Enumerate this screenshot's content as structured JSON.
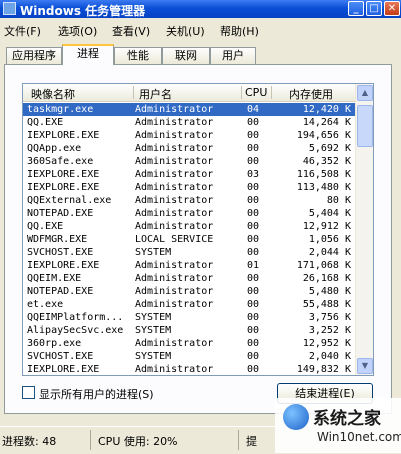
{
  "window": {
    "title": "Windows 任务管理器",
    "controls": [
      "_",
      "□",
      "✕"
    ]
  },
  "menu": [
    "文件(F)",
    "选项(O)",
    "查看(V)",
    "关机(U)",
    "帮助(H)"
  ],
  "tabs": [
    "应用程序",
    "进程",
    "性能",
    "联网",
    "用户"
  ],
  "active_tab": "进程",
  "columns": {
    "name": "映像名称",
    "user": "用户名",
    "cpu": "CPU",
    "mem": "内存使用"
  },
  "rows": [
    {
      "name": "taskmgr.exe",
      "user": "Administrator",
      "cpu": "04",
      "mem": "12,420 K",
      "selected": true
    },
    {
      "name": "QQ.EXE",
      "user": "Administrator",
      "cpu": "00",
      "mem": "14,264 K"
    },
    {
      "name": "IEXPLORE.EXE",
      "user": "Administrator",
      "cpu": "00",
      "mem": "194,656 K"
    },
    {
      "name": "QQApp.exe",
      "user": "Administrator",
      "cpu": "00",
      "mem": "5,692 K"
    },
    {
      "name": "360Safe.exe",
      "user": "Administrator",
      "cpu": "00",
      "mem": "46,352 K"
    },
    {
      "name": "IEXPLORE.EXE",
      "user": "Administrator",
      "cpu": "03",
      "mem": "116,508 K"
    },
    {
      "name": "IEXPLORE.EXE",
      "user": "Administrator",
      "cpu": "00",
      "mem": "113,480 K"
    },
    {
      "name": "QQExternal.exe",
      "user": "Administrator",
      "cpu": "00",
      "mem": "80 K"
    },
    {
      "name": "NOTEPAD.EXE",
      "user": "Administrator",
      "cpu": "00",
      "mem": "5,404 K"
    },
    {
      "name": "QQ.EXE",
      "user": "Administrator",
      "cpu": "00",
      "mem": "12,912 K"
    },
    {
      "name": "WDFMGR.EXE",
      "user": "LOCAL SERVICE",
      "cpu": "00",
      "mem": "1,056 K"
    },
    {
      "name": "SVCHOST.EXE",
      "user": "SYSTEM",
      "cpu": "00",
      "mem": "2,044 K"
    },
    {
      "name": "IEXPLORE.EXE",
      "user": "Administrator",
      "cpu": "01",
      "mem": "171,068 K"
    },
    {
      "name": "QQEIM.EXE",
      "user": "Administrator",
      "cpu": "00",
      "mem": "26,168 K"
    },
    {
      "name": "NOTEPAD.EXE",
      "user": "Administrator",
      "cpu": "00",
      "mem": "5,480 K"
    },
    {
      "name": "et.exe",
      "user": "Administrator",
      "cpu": "00",
      "mem": "55,488 K"
    },
    {
      "name": "QQEIMPlatform...",
      "user": "SYSTEM",
      "cpu": "00",
      "mem": "3,756 K"
    },
    {
      "name": "AlipaySecSvc.exe",
      "user": "SYSTEM",
      "cpu": "00",
      "mem": "3,252 K"
    },
    {
      "name": "360rp.exe",
      "user": "Administrator",
      "cpu": "00",
      "mem": "12,952 K"
    },
    {
      "name": "SVCHOST.EXE",
      "user": "SYSTEM",
      "cpu": "00",
      "mem": "2,040 K"
    },
    {
      "name": "IEXPLORE.EXE",
      "user": "Administrator",
      "cpu": "00",
      "mem": "149,832 K"
    }
  ],
  "show_all_users": {
    "label": "显示所有用户的进程(S)",
    "checked": false
  },
  "end_process_label": "结束进程(E)",
  "status": {
    "processes": "进程数: 48",
    "cpu": "CPU 使用: 20%",
    "commit": "提"
  },
  "watermark": {
    "title": "系统之家",
    "url": "Win10net.com"
  },
  "colors": {
    "title_bar": "#0a4fd6",
    "selection": "#316ac5",
    "face": "#ece9d8"
  }
}
